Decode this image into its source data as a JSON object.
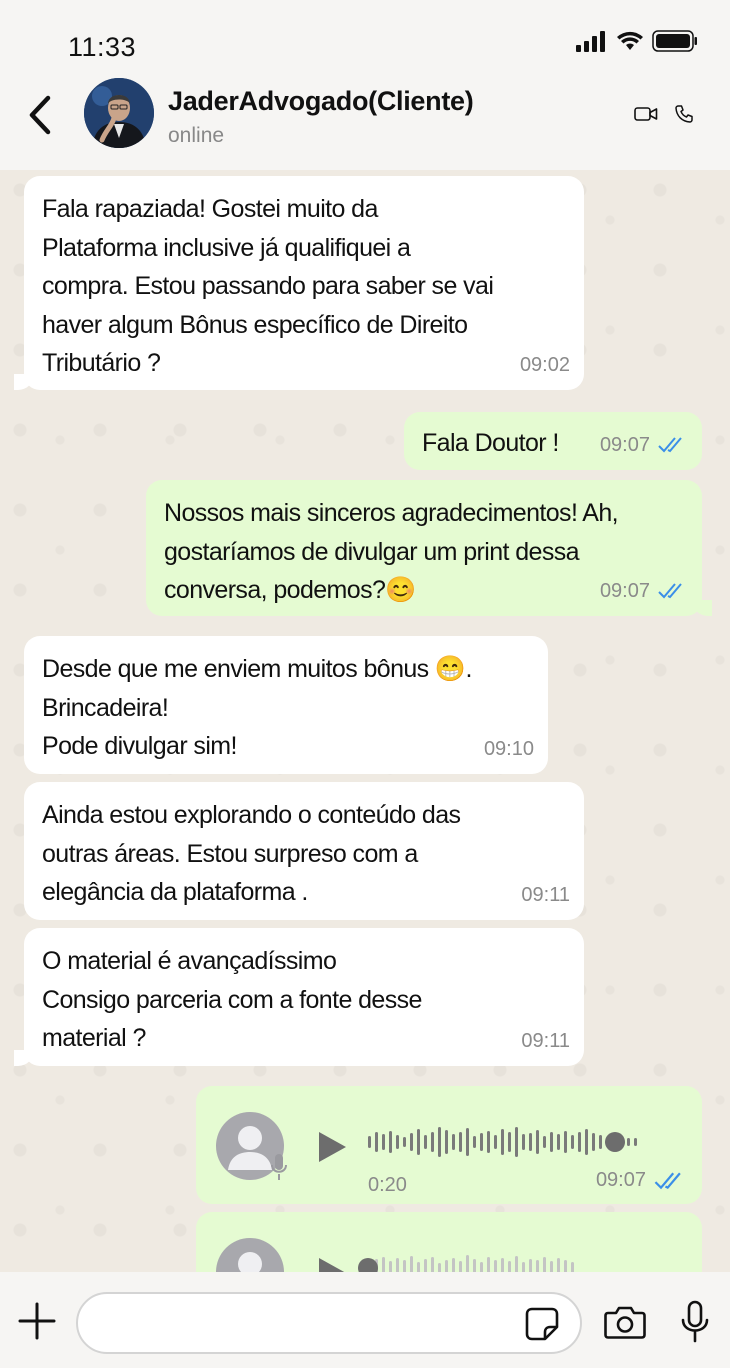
{
  "status_bar": {
    "time": "11:33"
  },
  "header": {
    "contact_name": "JaderAdvogado(Cliente)",
    "contact_status": "online"
  },
  "messages": [
    {
      "direction": "in",
      "text": "Fala rapaziada! Gostei muito da\nPlataforma inclusive já qualifiquei a\ncompra. Estou passando para saber se vai\nhaver algum Bônus específico de Direito\nTributário ?",
      "time": "09:02"
    },
    {
      "direction": "out",
      "text": "Fala Doutor !",
      "time": "09:07",
      "status": "read"
    },
    {
      "direction": "out",
      "text": "Nossos mais sinceros agradecimentos! Ah,\ngostaríamos de divulgar um print  dessa\nconversa, podemos?😊",
      "time": "09:07",
      "status": "read"
    },
    {
      "direction": "in",
      "text": "Desde que me enviem muitos bônus 😁.\nBrincadeira!\nPode divulgar sim!",
      "time": "09:10"
    },
    {
      "direction": "in",
      "text": "Ainda estou explorando o conteúdo das\noutras áreas. Estou surpreso com a\nelegância da plataforma .",
      "time": "09:11"
    },
    {
      "direction": "in",
      "text": "O material é avançadíssimo\nConsigo parceria com a fonte desse\nmaterial ?",
      "time": "09:11"
    }
  ],
  "voice_messages": [
    {
      "duration": "0:20",
      "time": "09:07",
      "status": "read",
      "progress": 0.92
    },
    {
      "duration": "",
      "time": "",
      "progress": 0.0
    }
  ],
  "colors": {
    "incoming_bubble": "#ffffff",
    "outgoing_bubble": "#e5fbd2",
    "read_ticks": "#3b8fe8",
    "chat_background": "#efeae2"
  },
  "icons": {
    "back": "chevron-left-icon",
    "video": "video-camera-icon",
    "phone": "phone-icon",
    "plus": "plus-icon",
    "sticker": "sticker-icon",
    "camera": "camera-icon",
    "mic": "microphone-icon"
  }
}
